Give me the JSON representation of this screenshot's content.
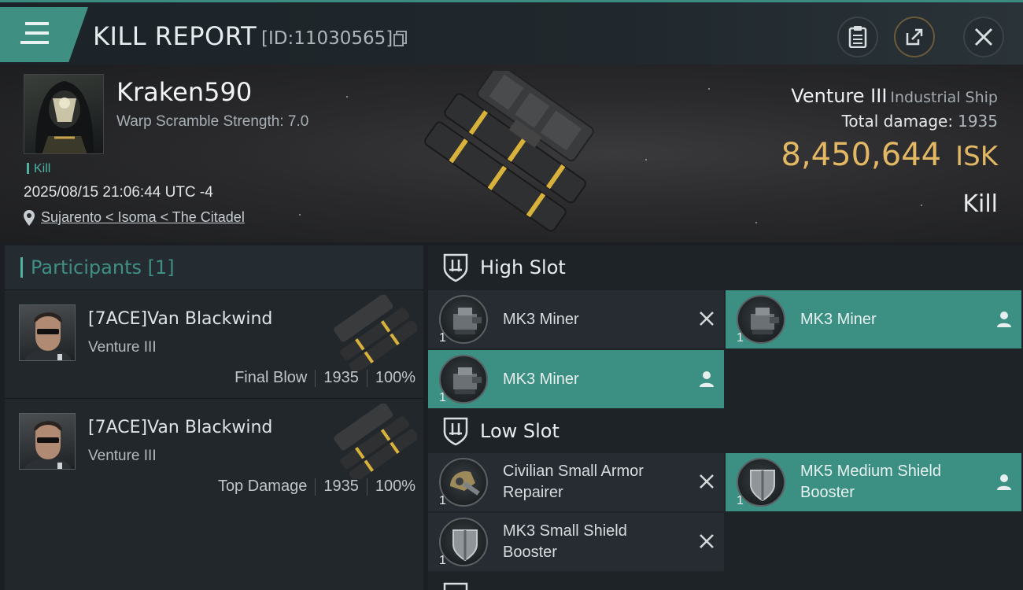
{
  "header": {
    "title": "KILL REPORT",
    "report_id": "[ID:11030565]"
  },
  "victim": {
    "name": "Kraken590",
    "warp_scramble": "Warp Scramble Strength: 7.0",
    "tag": "Kill",
    "datetime": "2025/08/15 21:06:44 UTC -4",
    "location": "Sujarento < Isoma < The Citadel",
    "ship_name": "Venture III",
    "ship_class": "Industrial Ship",
    "total_damage_label": "Total damage:",
    "total_damage_value": "1935",
    "isk_value": "8,450,644",
    "isk_unit": "ISK",
    "result": "Kill"
  },
  "participants": {
    "title": "Participants [1]",
    "rows": [
      {
        "name": "[7ACE]Van Blackwind",
        "ship": "Venture III",
        "role": "Final Blow",
        "damage": "1935",
        "percent": "100%"
      },
      {
        "name": "[7ACE]Van Blackwind",
        "ship": "Venture III",
        "role": "Top Damage",
        "damage": "1935",
        "percent": "100%"
      }
    ]
  },
  "slots": {
    "high": {
      "label": "High Slot",
      "modules": [
        {
          "name": "MK3 Miner",
          "qty": "1",
          "state": "destroyed"
        },
        {
          "name": "MK3 Miner",
          "qty": "1",
          "state": "dropped"
        },
        {
          "name": "MK3 Miner",
          "qty": "1",
          "state": "dropped"
        }
      ]
    },
    "low": {
      "label": "Low Slot",
      "modules": [
        {
          "name": "Civilian Small Armor Repairer",
          "qty": "1",
          "state": "destroyed"
        },
        {
          "name": "MK5 Medium Shield Booster",
          "qty": "1",
          "state": "dropped"
        },
        {
          "name": "MK3 Small Shield Booster",
          "qty": "1",
          "state": "destroyed"
        }
      ]
    }
  },
  "colors": {
    "accent_teal": "#3b8f83",
    "isk_gold": "#e3b864"
  }
}
